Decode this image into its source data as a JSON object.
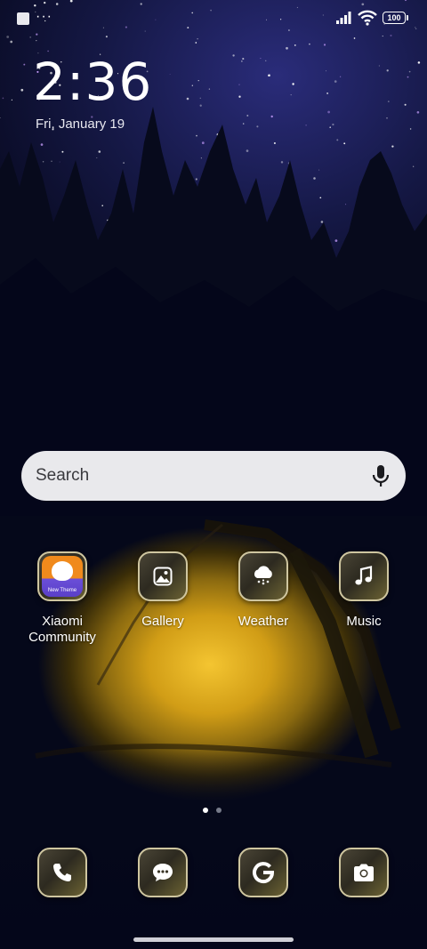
{
  "status_bar": {
    "more": "···",
    "battery": "100",
    "icons": [
      "notification-square-icon",
      "signal-icon",
      "wifi-icon",
      "battery-icon"
    ]
  },
  "lockscreen": {
    "time": "2:36",
    "date": "Fri, January 19"
  },
  "search": {
    "placeholder": "Search",
    "mic_icon": "microphone-icon"
  },
  "apps": [
    {
      "label": "Xiaomi\nCommunity",
      "icon": "xiaomi-community-icon",
      "badge_text": "New Theme"
    },
    {
      "label": "Gallery",
      "icon": "gallery-icon"
    },
    {
      "label": "Weather",
      "icon": "weather-icon"
    },
    {
      "label": "Music",
      "icon": "music-icon"
    }
  ],
  "pages": {
    "count": 2,
    "active": 1
  },
  "dock": [
    {
      "icon": "phone-icon"
    },
    {
      "icon": "messages-icon"
    },
    {
      "icon": "google-icon"
    },
    {
      "icon": "camera-icon"
    }
  ],
  "colors": {
    "tile_border": "#cfc6a0",
    "search_bg": "#e9e9ec",
    "tent_glow": "#f4c531"
  }
}
